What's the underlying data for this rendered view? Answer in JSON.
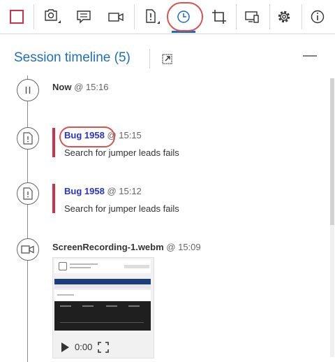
{
  "toolbar": {
    "buttons": [
      {
        "name": "stop-recording",
        "icon": "stop-square-icon"
      },
      {
        "name": "capture-screenshot",
        "icon": "camera-icon"
      },
      {
        "name": "add-note",
        "icon": "note-icon"
      },
      {
        "name": "record-video",
        "icon": "video-camera-icon"
      },
      {
        "name": "create-bug",
        "icon": "bug-page-icon"
      },
      {
        "name": "timeline",
        "icon": "clock-icon"
      },
      {
        "name": "explore",
        "icon": "crop-rotate-icon"
      },
      {
        "name": "connections",
        "icon": "monitor-icon"
      },
      {
        "name": "settings",
        "icon": "gear-icon"
      },
      {
        "name": "info",
        "icon": "info-icon"
      }
    ],
    "active": "timeline"
  },
  "header": {
    "title": "Session timeline (5)"
  },
  "timeline": {
    "entries": [
      {
        "type": "now",
        "label": "Now",
        "time": "@ 15:16"
      },
      {
        "type": "bug",
        "label": "Bug 1958",
        "time": "@ 15:15",
        "description": "Search for jumper leads fails"
      },
      {
        "type": "bug",
        "label": "Bug 1958",
        "time": "@ 15:12",
        "description": "Search for jumper leads fails"
      },
      {
        "type": "video",
        "label": "ScreenRecording-1.webm",
        "time": "@ 15:09",
        "player_time": "0:00"
      }
    ]
  },
  "colors": {
    "accent": "#1e6fb8",
    "bug_bar": "#d1324b",
    "link": "#2a34c8",
    "highlight": "#d9534f"
  }
}
